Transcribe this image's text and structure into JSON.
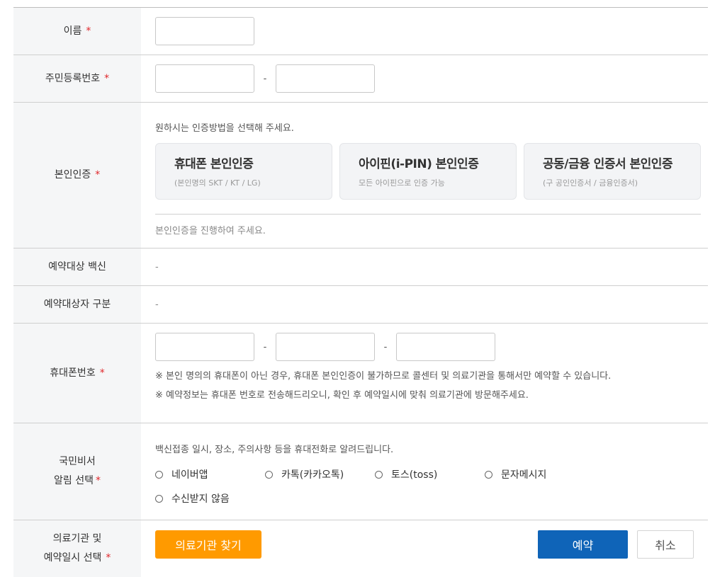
{
  "required_mark": "*",
  "name": {
    "label": "이름",
    "value": ""
  },
  "rrn": {
    "label": "주민등록번호",
    "separator": "-",
    "front_value": "",
    "back_value": ""
  },
  "identity": {
    "label": "본인인증",
    "guide": "원하시는 인증방법을 선택해 주세요.",
    "options": [
      {
        "title": "휴대폰 본인인증",
        "sub": "(본인명의 SKT / KT / LG)"
      },
      {
        "title": "아이핀(i-PIN) 본인인증",
        "sub": "모든 아이핀으로 인증 가능"
      },
      {
        "title": "공동/금융 인증서 본인인증",
        "sub": "(구 공인인증서 / 금융인증서)"
      }
    ],
    "status": "본인인증을 진행하여 주세요."
  },
  "vaccine": {
    "label": "예약대상 백신",
    "value": "-"
  },
  "target_type": {
    "label": "예약대상자 구분",
    "value": "-"
  },
  "phone": {
    "label": "휴대폰번호",
    "separator": "-",
    "values": [
      "",
      "",
      ""
    ],
    "notes": [
      "※ 본인 명의의 휴대폰이 아닌 경우, 휴대폰 본인인증이 불가하므로 콜센터 및 의료기관을 통해서만 예약할 수 있습니다.",
      "※ 예약정보는 휴대폰 번호로 전송해드리오니, 확인 후 예약일시에 맞춰 의료기관에 방문해주세요."
    ]
  },
  "notify": {
    "label_line1": "국민비서",
    "label_line2": "알림 선택",
    "guide": "백신접종 일시, 장소, 주의사항 등을 휴대전화로 알려드립니다.",
    "options": [
      "네이버앱",
      "카톡(카카오톡)",
      "토스(toss)",
      "문자메시지",
      "수신받지 않음"
    ]
  },
  "facility": {
    "label_line1": "의료기관 및",
    "label_line2": "예약일시 선택",
    "find_button": "의료기관 찾기",
    "reserve_button": "예약",
    "cancel_button": "취소"
  },
  "colors": {
    "accent_orange": "#ff9a00",
    "primary_blue": "#0f64b8",
    "required_red": "#e0262a"
  }
}
